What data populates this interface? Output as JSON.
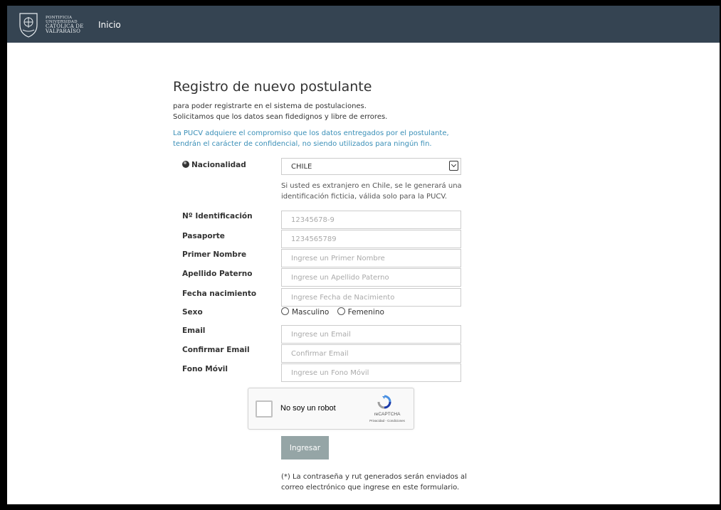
{
  "nav": {
    "logo_line1": "PONTIFICIA",
    "logo_line2": "UNIVERSIDAD",
    "logo_line3": "CATÓLICA DE",
    "logo_line4": "VALPARAÍSO",
    "inicio": "Inicio"
  },
  "form": {
    "title": "Registro de nuevo postulante",
    "intro_line1": "para poder registrarte en el sistema de postulaciones.",
    "intro_line2": "Solicitamos que los datos sean fidedignos y libre de errores.",
    "notice_line1": "La PUCV adquiere el compromiso que los datos entregados por el postulante,",
    "notice_line2": "tendrán el carácter de confidencial, no siendo utilizados para ningún fin.",
    "nationality": {
      "label": "Nacionalidad",
      "value": "CHILE",
      "help_line1": "Si usted es extranjero en Chile, se le generará una",
      "help_line2": "identificación ficticia, válida solo para la PUCV."
    },
    "fields": {
      "id_label": "Nº Identificación",
      "id_placeholder": "12345678-9",
      "passport_label": "Pasaporte",
      "passport_placeholder": "1234565789",
      "first_name_label": "Primer Nombre",
      "first_name_placeholder": "Ingrese un Primer Nombre",
      "last_name_label": "Apellido Paterno",
      "last_name_placeholder": "Ingrese un Apellido Paterno",
      "birth_label": "Fecha nacimiento",
      "birth_placeholder": "Ingrese Fecha de Nacimiento",
      "sex_label": "Sexo",
      "sex_male": "Masculino",
      "sex_female": "Femenino",
      "email_label": "Email",
      "email_placeholder": "Ingrese un Email",
      "email_confirm_label": "Confirmar Email",
      "email_confirm_placeholder": "Confirmar Email",
      "phone_label": "Fono Móvil",
      "phone_placeholder": "Ingrese un Fono Móvil"
    },
    "captcha": {
      "text": "No soy un robot",
      "brand": "reCAPTCHA",
      "links": "Privacidad - Condiciones"
    },
    "submit": "Ingresar",
    "note_line1": "(*) La contraseña y rut generados serán enviados al",
    "note_line2": "correo electrónico que ingrese en este formulario."
  },
  "colors": {
    "navbar": "#354452",
    "notice": "#3a8fb7",
    "button": "#95a5a6"
  }
}
